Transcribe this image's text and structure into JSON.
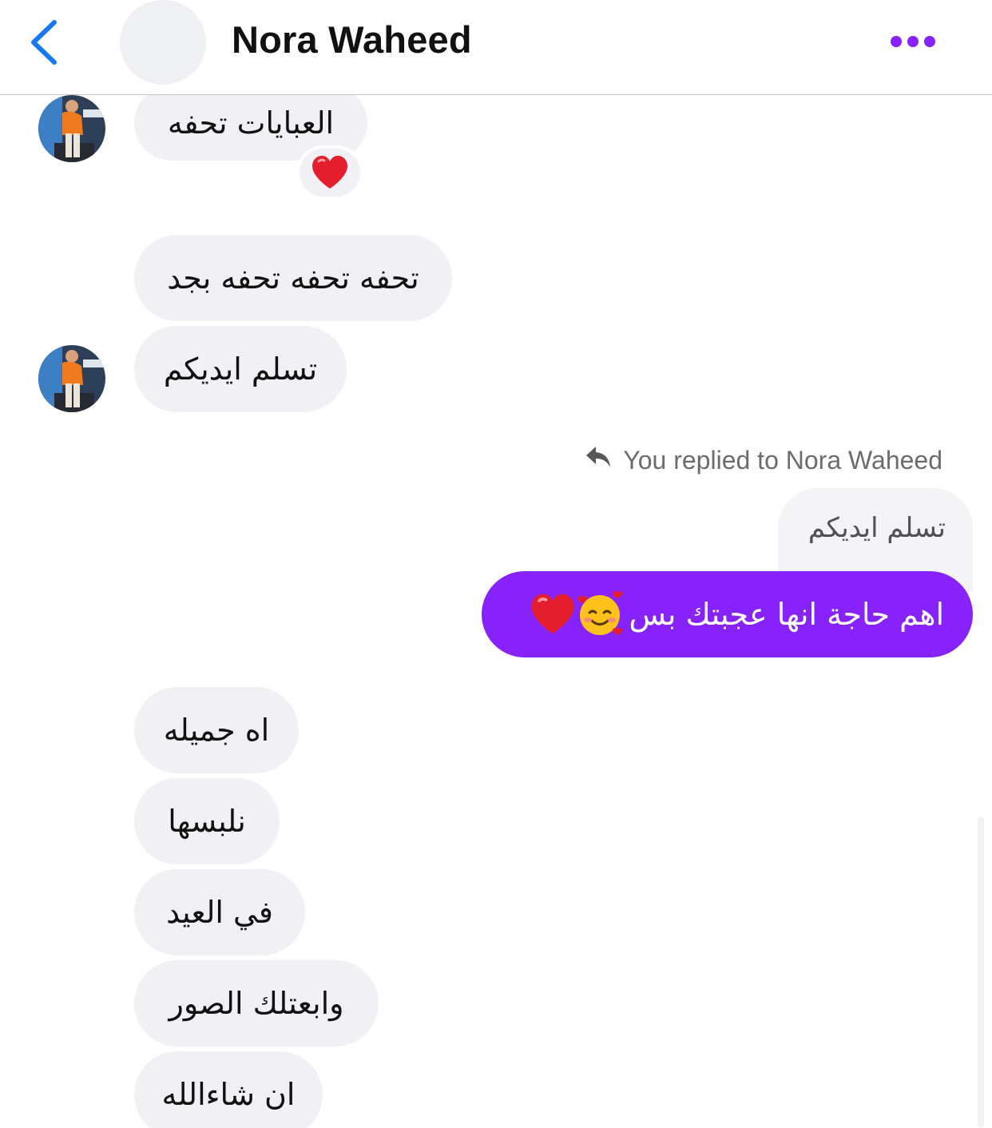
{
  "header": {
    "contact_name": "Nora Waheed"
  },
  "messages_received": [
    {
      "text": "العبايات تحفه",
      "reaction": "red-heart"
    },
    {
      "text": "تحفه تحفه تحفه بجد"
    },
    {
      "text": "تسلم ايديكم"
    },
    {
      "text": "اه جميله"
    },
    {
      "text": "نلبسها"
    },
    {
      "text": "في العيد"
    },
    {
      "text": "وابعتلك الصور"
    },
    {
      "text": "ان شاءالله"
    }
  ],
  "reply": {
    "label": "You replied to Nora Waheed",
    "quoted_text": "تسلم ايديكم",
    "sent_text": "اهم حاجة انها عجبتك بس",
    "sent_emojis": [
      "smiling-face-with-hearts",
      "red-heart"
    ]
  },
  "colors": {
    "accent": "#8822fb",
    "back_arrow": "#1877f2",
    "received_bubble": "#f1f1f5",
    "heart": "#e41e2c"
  },
  "icons": {
    "back": "chevron-left-icon",
    "more": "more-dots-icon",
    "reply": "reply-arrow-icon"
  }
}
